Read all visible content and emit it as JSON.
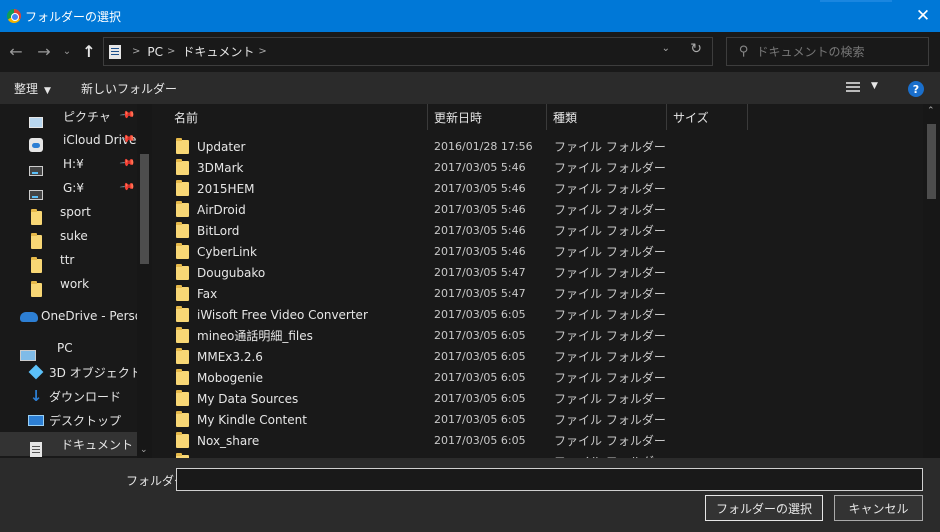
{
  "window": {
    "title": "フォルダーの選択",
    "close_label": "✕"
  },
  "nav": {
    "back": "←",
    "forward": "→",
    "recent": "⌄",
    "up": "↑",
    "breadcrumbs": [
      "PC",
      "ドキュメント"
    ],
    "refresh": "↻",
    "search_placeholder": "ドキュメントの検索"
  },
  "toolbar": {
    "organize": "整理",
    "new_folder": "新しいフォルダー",
    "help": "?"
  },
  "sidebar": {
    "items": [
      {
        "label": "ピクチャ",
        "icon": "pictures-icon",
        "pinned": true
      },
      {
        "label": "iCloud Drive",
        "icon": "icloud-icon",
        "pinned": true
      },
      {
        "label": "H:¥",
        "icon": "drive-icon",
        "pinned": true
      },
      {
        "label": "G:¥",
        "icon": "drive-icon",
        "pinned": true
      },
      {
        "label": "sport",
        "icon": "folder-icon"
      },
      {
        "label": "suke",
        "icon": "folder-icon"
      },
      {
        "label": "ttr",
        "icon": "folder-icon"
      },
      {
        "label": "work",
        "icon": "folder-icon"
      },
      {
        "label": "OneDrive - Person",
        "icon": "onedrive-icon"
      },
      {
        "label": "PC",
        "icon": "pc-icon"
      },
      {
        "label": "3D オブジェクト",
        "icon": "3d-objects-icon"
      },
      {
        "label": "ダウンロード",
        "icon": "download-icon"
      },
      {
        "label": "デスクトップ",
        "icon": "desktop-icon"
      },
      {
        "label": "ドキュメント",
        "icon": "documents-icon",
        "selected": true
      }
    ]
  },
  "columns": {
    "name": "名前",
    "date": "更新日時",
    "type": "種類",
    "size": "サイズ"
  },
  "files": [
    {
      "name": "Updater",
      "date": "2016/01/28 17:56",
      "type": "ファイル フォルダー"
    },
    {
      "name": "3DMark",
      "date": "2017/03/05 5:46",
      "type": "ファイル フォルダー"
    },
    {
      "name": "2015HEM",
      "date": "2017/03/05 5:46",
      "type": "ファイル フォルダー"
    },
    {
      "name": "AirDroid",
      "date": "2017/03/05 5:46",
      "type": "ファイル フォルダー"
    },
    {
      "name": "BitLord",
      "date": "2017/03/05 5:46",
      "type": "ファイル フォルダー"
    },
    {
      "name": "CyberLink",
      "date": "2017/03/05 5:46",
      "type": "ファイル フォルダー"
    },
    {
      "name": "Dougubako",
      "date": "2017/03/05 5:47",
      "type": "ファイル フォルダー"
    },
    {
      "name": "Fax",
      "date": "2017/03/05 5:47",
      "type": "ファイル フォルダー"
    },
    {
      "name": "iWisoft Free Video Converter",
      "date": "2017/03/05 6:05",
      "type": "ファイル フォルダー"
    },
    {
      "name": "mineo通話明細_files",
      "date": "2017/03/05 6:05",
      "type": "ファイル フォルダー"
    },
    {
      "name": "MMEx3.2.6",
      "date": "2017/03/05 6:05",
      "type": "ファイル フォルダー"
    },
    {
      "name": "Mobogenie",
      "date": "2017/03/05 6:05",
      "type": "ファイル フォルダー"
    },
    {
      "name": "My Data Sources",
      "date": "2017/03/05 6:05",
      "type": "ファイル フォルダー"
    },
    {
      "name": "My Kindle Content",
      "date": "2017/03/05 6:05",
      "type": "ファイル フォルダー"
    },
    {
      "name": "Nox_share",
      "date": "2017/03/05 6:05",
      "type": "ファイル フォルダー"
    },
    {
      "name": "",
      "date": "",
      "type": "ファイル フォルダー"
    }
  ],
  "footer": {
    "folder_label": "フォルダー:",
    "folder_value": "",
    "select_button": "フォルダーの選択",
    "cancel_button": "キャンセル"
  },
  "colors": {
    "titlebar": "#0078d7",
    "background": "#191919",
    "toolbar": "#2b2b2b",
    "folder": "#f8d775"
  }
}
